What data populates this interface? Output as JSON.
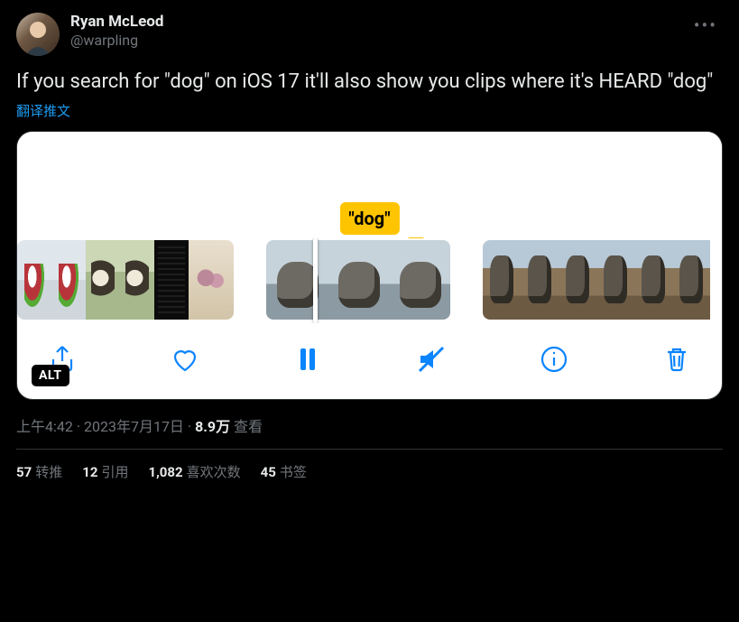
{
  "author": {
    "display_name": "Ryan McLeod",
    "handle": "@warpling"
  },
  "tweet_text": "If you search for \"dog\" on iOS 17 it'll also show you clips where it's HEARD \"dog\"",
  "translate_label": "翻译推文",
  "media": {
    "highlight_label": "\"dog\"",
    "alt_badge": "ALT",
    "controls": {
      "share": "share-icon",
      "like": "heart-icon",
      "pause": "pause-icon",
      "mute": "mute-icon",
      "info": "info-icon",
      "trash": "trash-icon"
    }
  },
  "meta": {
    "time": "上午4:42",
    "dot": " · ",
    "date": "2023年7月17日",
    "views_count": "8.9万",
    "views_label": " 查看"
  },
  "stats": {
    "retweets": {
      "count": "57",
      "label": "转推"
    },
    "quotes": {
      "count": "12",
      "label": "引用"
    },
    "likes": {
      "count": "1,082",
      "label": "喜欢次数"
    },
    "bookmarks": {
      "count": "45",
      "label": "书签"
    }
  }
}
